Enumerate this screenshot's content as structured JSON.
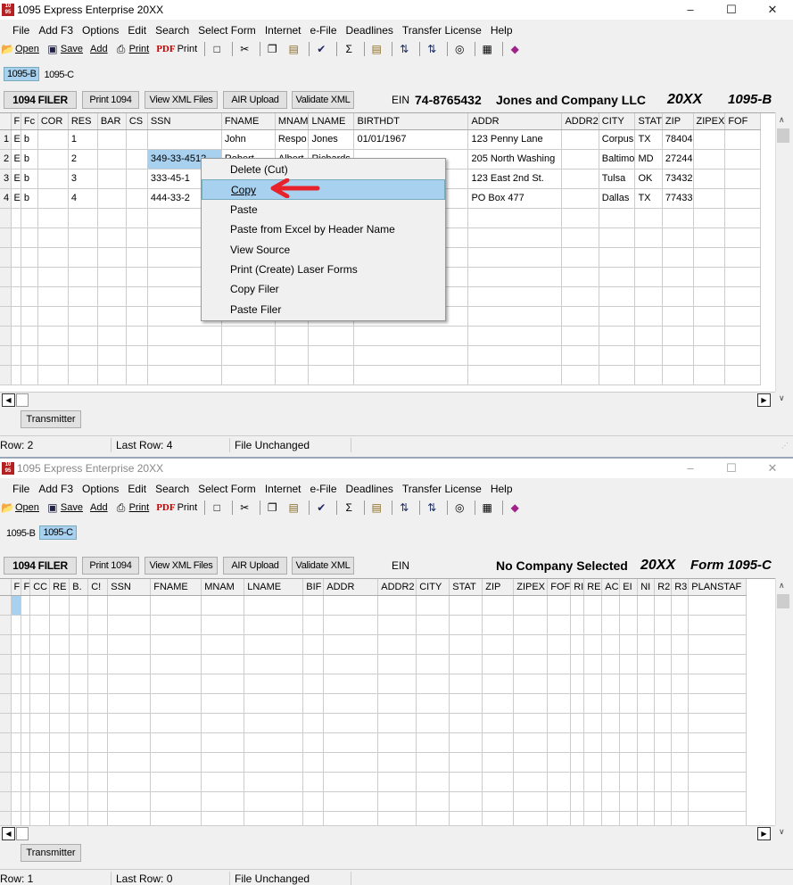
{
  "windows": [
    {
      "title": "1095 Express Enterprise 20XX",
      "app_icon": "1095-express-icon",
      "menu": [
        "File",
        "Add F3",
        "Options",
        "Edit",
        "Search",
        "Select Form",
        "Internet",
        "e-File",
        "Deadlines",
        "Transfer License",
        "Help"
      ],
      "toolbar": {
        "open": "Open",
        "save": "Save",
        "add": "Add",
        "print": "Print",
        "pdf": "PDF",
        "pdf_print": "Print"
      },
      "tabs": [
        "1095-B",
        "1095-C"
      ],
      "active_tab": 0,
      "buttons": {
        "filer": "1094 FILER",
        "print1094": "Print 1094",
        "xml": "View XML Files",
        "air": "AIR Upload",
        "validate": "Validate XML"
      },
      "ein_label": "EIN",
      "ein": "74-8765432",
      "company": "Jones and Company LLC",
      "year": "20XX",
      "form": "1095-B",
      "columns": [
        "F",
        "Fc",
        "COR",
        "RES",
        "BAR",
        "CS",
        "SSN",
        "FNAME",
        "MNAM",
        "LNAME",
        "BIRTHDT",
        "ADDR",
        "ADDR2",
        "CITY",
        "STAT",
        "ZIP",
        "ZIPEX",
        "FOF"
      ],
      "rows": [
        [
          "1",
          "E",
          "b",
          "",
          "1",
          "",
          "",
          "",
          "John",
          "Respo",
          "Jones",
          "01/01/1967",
          "123 Penny Lane",
          "",
          "Corpus",
          "TX",
          "78404",
          "",
          ""
        ],
        [
          "2",
          "E",
          "b",
          "",
          "2",
          "",
          "",
          "349-33-4512",
          "Robert",
          "Albert",
          "Richards",
          "",
          "205 North Washing",
          "",
          "Baltimo",
          "MD",
          "27244",
          "",
          ""
        ],
        [
          "3",
          "E",
          "b",
          "",
          "3",
          "",
          "",
          "333-45-1",
          "",
          "",
          "",
          "",
          "123 East 2nd St.",
          "",
          "Tulsa",
          "OK",
          "73432",
          "",
          ""
        ],
        [
          "4",
          "E",
          "b",
          "",
          "4",
          "",
          "",
          "444-33-2",
          "",
          "",
          "",
          "",
          "PO Box 477",
          "",
          "Dallas",
          "TX",
          "77433",
          "",
          ""
        ]
      ],
      "transmitter": "Transmitter",
      "status": {
        "row": "Row: 2",
        "last_row": "Last Row: 4",
        "file": "File Unchanged"
      }
    },
    {
      "title": "1095 Express Enterprise 20XX",
      "app_icon": "1095-express-icon",
      "menu": [
        "File",
        "Add F3",
        "Options",
        "Edit",
        "Search",
        "Select Form",
        "Internet",
        "e-File",
        "Deadlines",
        "Transfer License",
        "Help"
      ],
      "toolbar": {
        "open": "Open",
        "save": "Save",
        "add": "Add",
        "print": "Print",
        "pdf": "PDF",
        "pdf_print": "Print"
      },
      "tabs": [
        "1095-B",
        "1095-C"
      ],
      "active_tab": 1,
      "buttons": {
        "filer": "1094 FILER",
        "print1094": "Print 1094",
        "xml": "View XML Files",
        "air": "AIR Upload",
        "validate": "Validate XML"
      },
      "ein_label": "EIN",
      "company": "No Company Selected",
      "year": "20XX",
      "form": "Form 1095-C",
      "columns": [
        "F",
        "F",
        "CC",
        "RE",
        "B.",
        "C!",
        "SSN",
        "FNAME",
        "MNAM",
        "LNAME",
        "BIF",
        "ADDR",
        "ADDR2",
        "CITY",
        "STAT",
        "ZIP",
        "ZIPEX",
        "FOF",
        "RI",
        "RE",
        "AC",
        "EI",
        "NI",
        "R2",
        "R3",
        "PLANSTAF"
      ],
      "transmitter": "Transmitter",
      "status": {
        "row": "Row: 1",
        "last_row": "Last Row: 0",
        "file": "File Unchanged"
      }
    }
  ],
  "context_menu": {
    "items": [
      "Delete (Cut)",
      "Copy",
      "Paste",
      "Paste from Excel by Header Name",
      "View Source",
      "Print (Create) Laser Forms",
      "Copy Filer",
      "Paste Filer"
    ],
    "highlighted": 1
  },
  "arrow_color": "#e8222a",
  "accent": "#a8d1f0"
}
